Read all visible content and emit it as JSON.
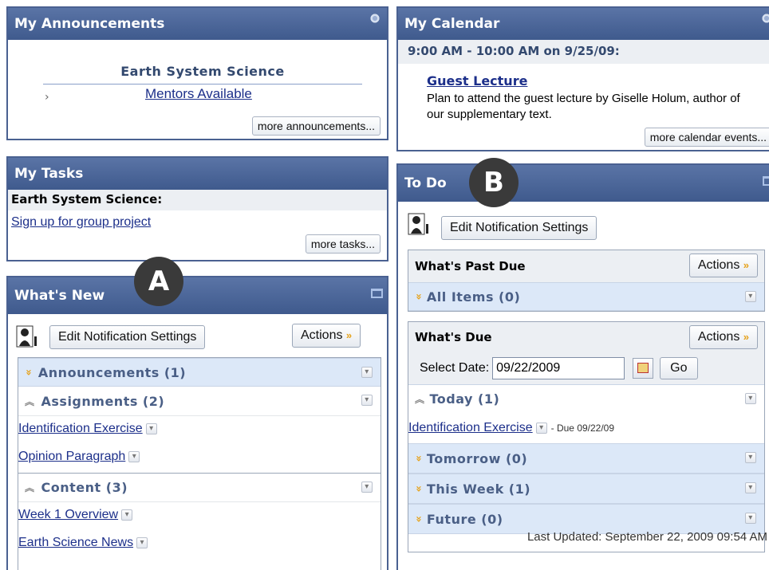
{
  "announcements": {
    "title": "My Announcements",
    "course": "Earth System Science",
    "item": "Mentors Available",
    "more": "more announcements..."
  },
  "tasks": {
    "title": "My Tasks",
    "course": "Earth System Science:",
    "item": "Sign up for group project",
    "more": "more tasks..."
  },
  "whats_new": {
    "title": "What's New",
    "edit_btn": "Edit Notification Settings",
    "actions_btn": "Actions",
    "sections": [
      {
        "label": "Announcements (1)"
      },
      {
        "label": "Assignments (2)",
        "items": [
          "Identification Exercise",
          "Opinion Paragraph"
        ]
      },
      {
        "label": "Content (3)",
        "items": [
          "Week 1 Overview",
          "Earth Science News"
        ]
      }
    ]
  },
  "calendar": {
    "title": "My Calendar",
    "time": "9:00 AM - 10:00 AM on 9/25/09:",
    "event": "Guest Lecture",
    "desc": "Plan to attend the guest lecture by Giselle Holum, author of our supplementary text.",
    "more": "more calendar events..."
  },
  "todo": {
    "title": "To Do",
    "edit_btn": "Edit Notification Settings",
    "past_due": {
      "title": "What's Past Due",
      "actions_btn": "Actions",
      "all_items": "All Items (0)"
    },
    "whats_due": {
      "title": "What's Due",
      "actions_btn": "Actions",
      "select_label": "Select Date:",
      "date_value": "09/22/2009",
      "go_btn": "Go",
      "today": "Today (1)",
      "today_item": "Identification Exercise",
      "today_due": "- Due 09/22/09",
      "tomorrow": "Tomorrow (0)",
      "this_week": "This Week (1)",
      "future": "Future (0)"
    },
    "last_updated": "Last Updated: September 22, 2009 09:54 AM"
  },
  "callouts": {
    "a": "A",
    "b": "B"
  },
  "colors": {
    "header": "#4a6191",
    "section_bar": "#dce8f8",
    "link": "#1c2f8a",
    "chevron": "#e6a21a"
  },
  "icons": [
    "gear-icon",
    "minimize-icon",
    "person-icon",
    "chevron-down-icon",
    "chevron-up-icon",
    "calendar-icon",
    "arrow-right-icon"
  ]
}
